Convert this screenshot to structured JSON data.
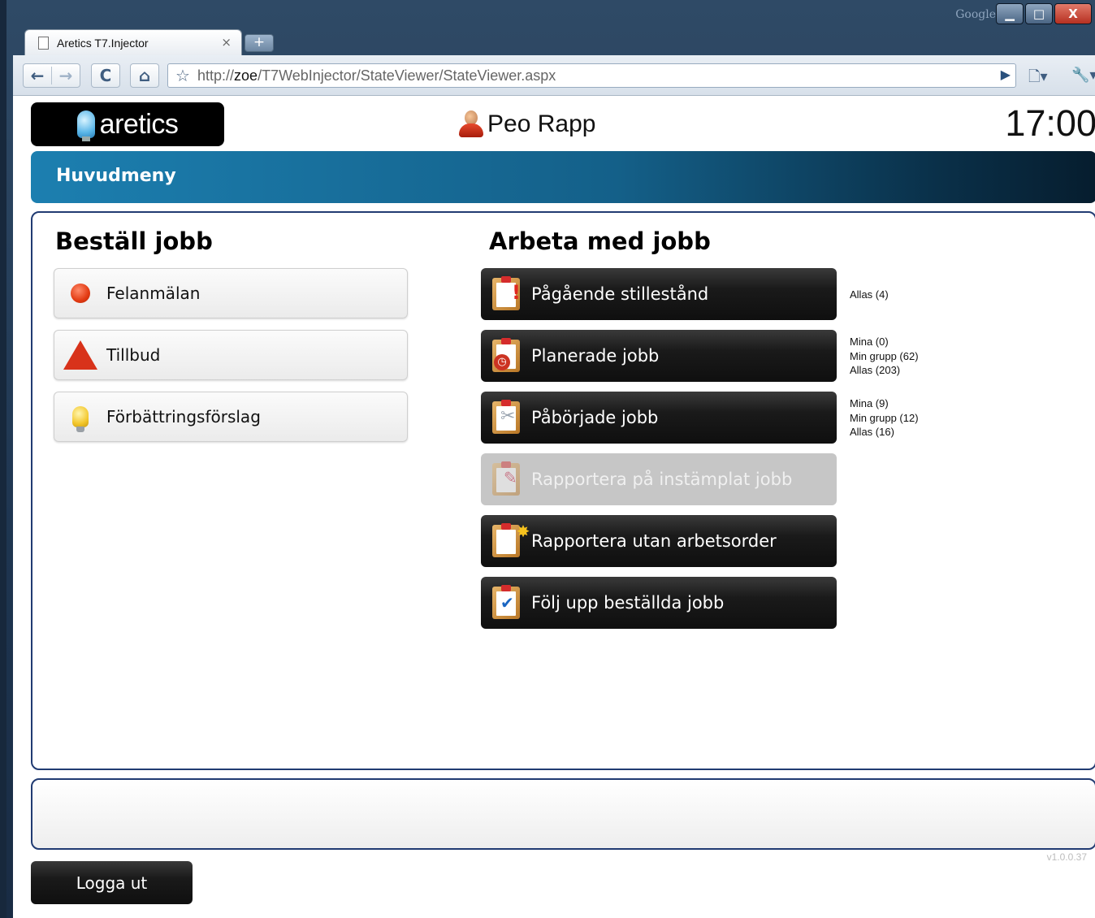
{
  "browser": {
    "brand": "Google",
    "tab": {
      "title": "Aretics T7.Injector",
      "close_glyph": "×"
    },
    "new_tab_glyph": "+",
    "window_controls": {
      "minimize": "▁",
      "maximize": "□",
      "close": "X"
    },
    "toolbar": {
      "back": "←",
      "forward": "→",
      "reload": "C",
      "home": "⌂",
      "star": "☆",
      "go": "▶",
      "page_menu": "🗋▾",
      "wrench_menu": "🔧▾"
    },
    "url": {
      "scheme": "http://",
      "host": "zoe",
      "path": "/T7WebInjector/StateViewer/StateViewer.aspx"
    }
  },
  "header": {
    "logo_text": "aretics",
    "user_name": "Peo Rapp",
    "time": "17:00"
  },
  "titlebar": {
    "title": "Huvudmeny"
  },
  "order_section": {
    "title": "Beställ jobb",
    "buttons": [
      {
        "label": "Felanmälan",
        "icon": "red-dot-icon"
      },
      {
        "label": "Tillbud",
        "icon": "warning-triangle-icon"
      },
      {
        "label": "Förbättringsförslag",
        "icon": "lightbulb-icon"
      }
    ]
  },
  "work_section": {
    "title": "Arbeta med jobb",
    "buttons": [
      {
        "label": "Pågående stillestånd",
        "icon": "clipboard-alert-icon",
        "enabled": true,
        "counts": [
          "Allas (4)"
        ]
      },
      {
        "label": "Planerade jobb",
        "icon": "clipboard-clock-icon",
        "enabled": true,
        "counts": [
          "Mina (0)",
          "Min grupp (62)",
          "Allas (203)"
        ]
      },
      {
        "label": "Påbörjade jobb",
        "icon": "clipboard-tools-icon",
        "enabled": true,
        "counts": [
          "Mina (9)",
          "Min grupp (12)",
          "Allas (16)"
        ]
      },
      {
        "label": "Rapportera på instämplat jobb",
        "icon": "clipboard-pen-icon",
        "enabled": false,
        "counts": []
      },
      {
        "label": "Rapportera utan arbetsorder",
        "icon": "clipboard-star-icon",
        "enabled": true,
        "counts": []
      },
      {
        "label": "Följ upp beställda jobb",
        "icon": "checklist-icon",
        "enabled": true,
        "counts": []
      }
    ]
  },
  "footer": {
    "version": "v1.0.0.37",
    "logout_label": "Logga ut"
  },
  "colors": {
    "titlebar_start": "#1c7fb0",
    "titlebar_end": "#061d2e",
    "panel_border": "#213b72",
    "job_button": "#1a1a1a",
    "job_button_disabled": "#c6c6c6"
  }
}
